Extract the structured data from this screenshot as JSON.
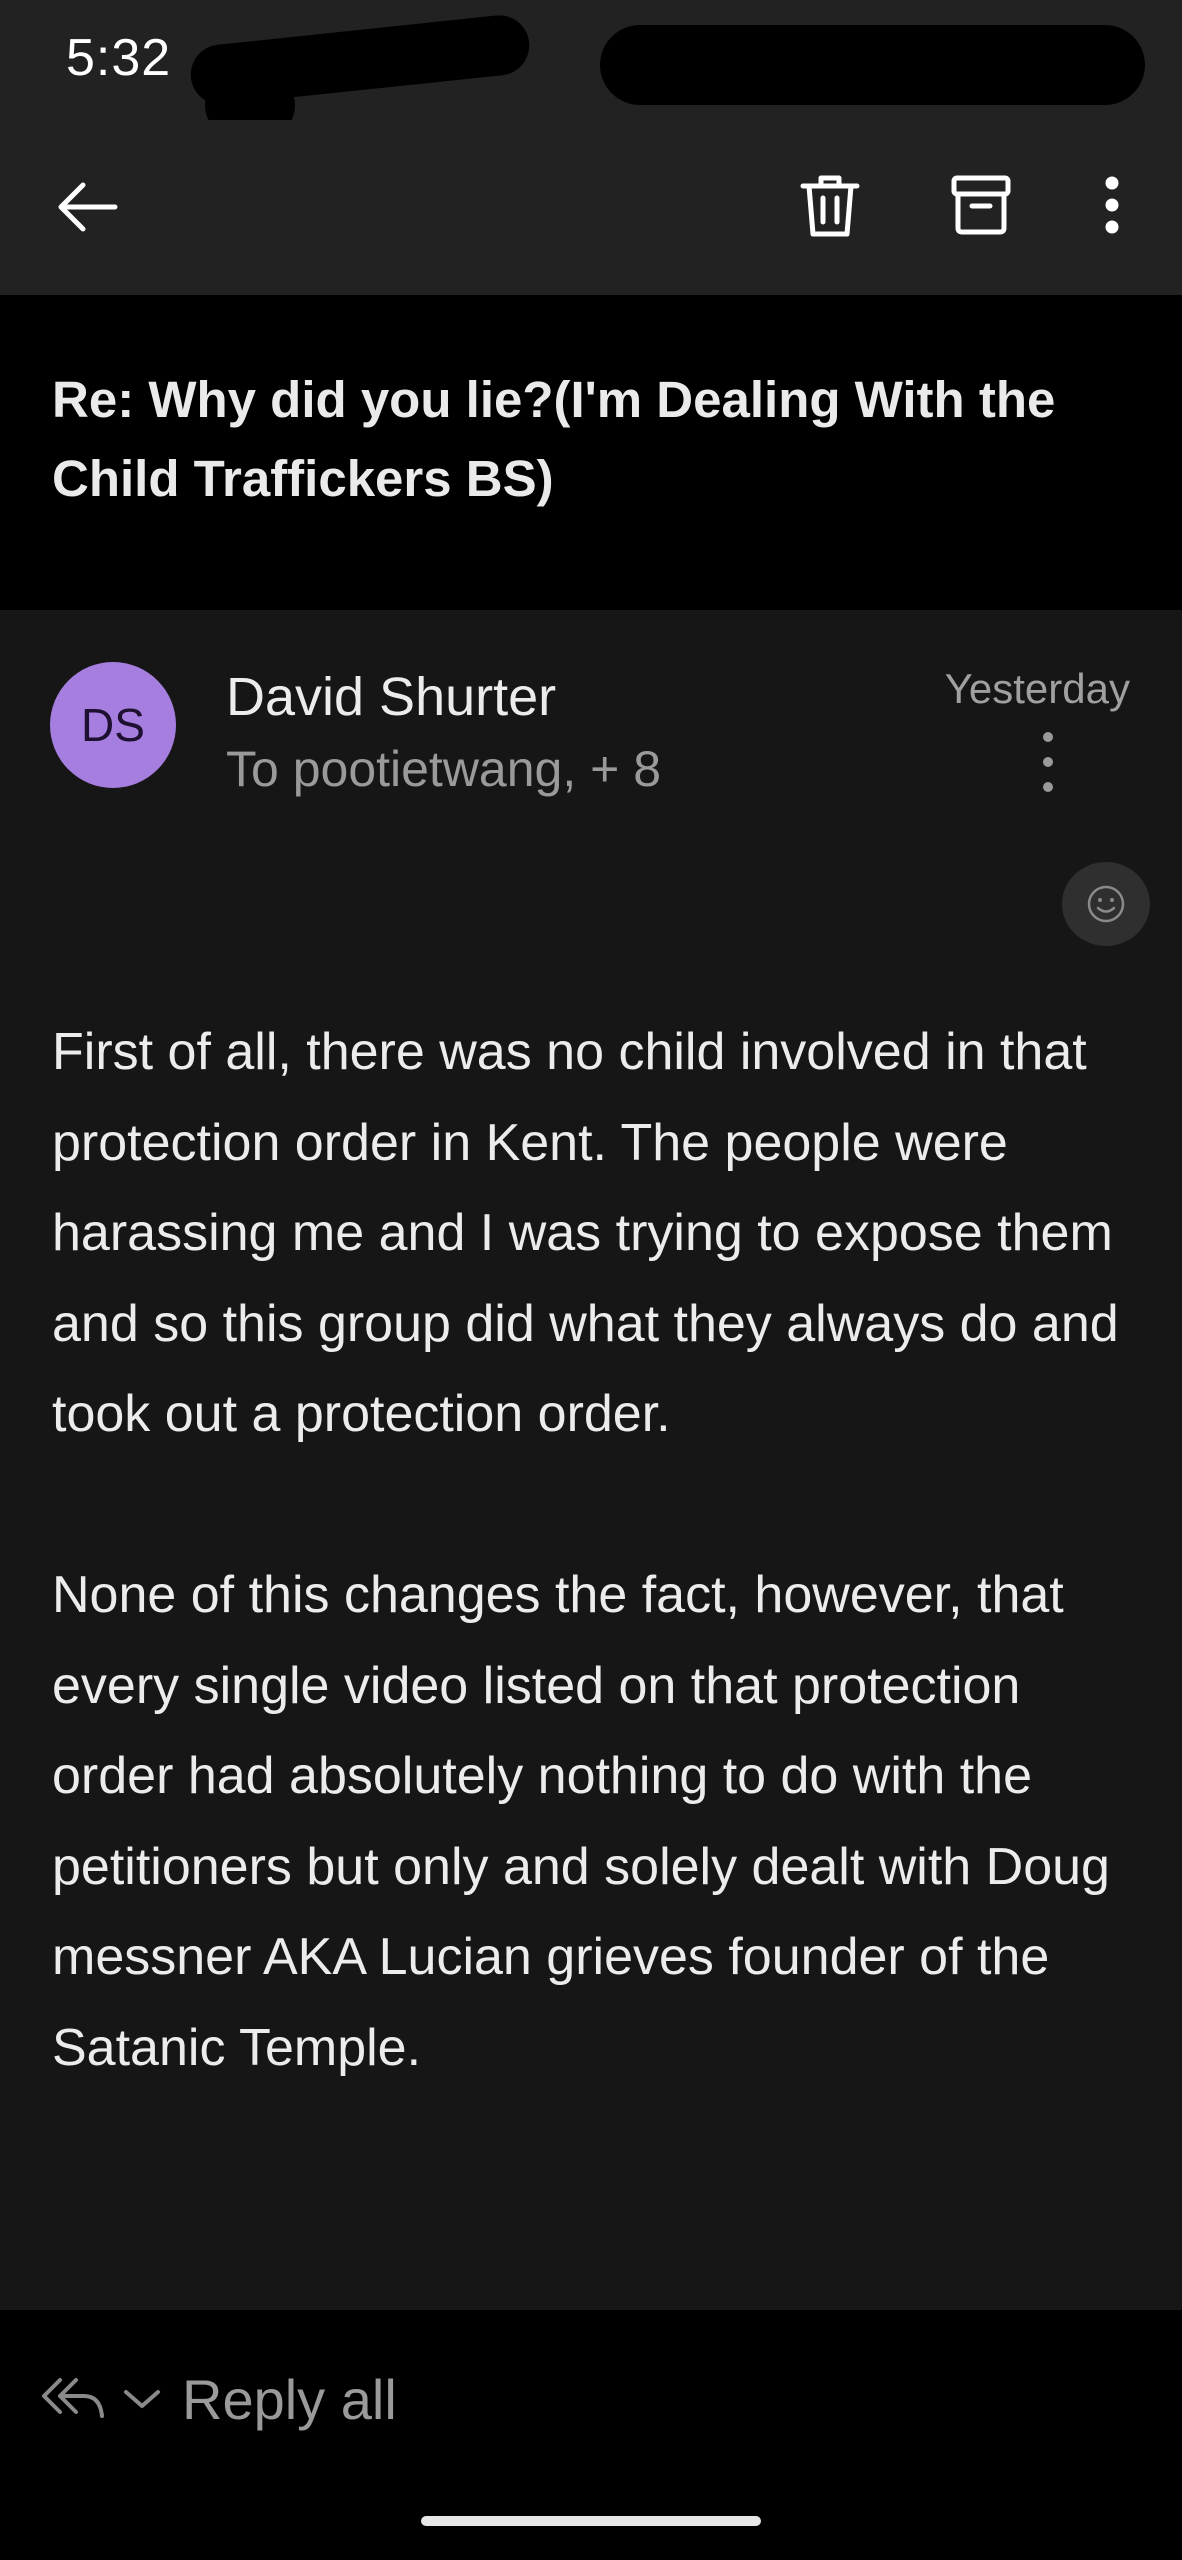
{
  "status_bar": {
    "time": "5:32"
  },
  "toolbar": {
    "back_icon": "arrow-left-icon",
    "delete_icon": "trash-icon",
    "archive_icon": "archive-box-icon",
    "more_icon": "kebab-vertical-icon"
  },
  "subject": "Re: Why did you lie?(I'm Dealing With the Child Traffickers BS)",
  "message": {
    "avatar_initials": "DS",
    "avatar_color": "#a67ee0",
    "sender": "David Shurter",
    "recipients": "To pootietwang, + 8",
    "date": "Yesterday",
    "paragraphs": [
      "First of all, there was no child involved in that protection order in Kent. The people were harassing me and I was trying to expose them and so this group did what they always do and took out a protection order.",
      "None of this changes the fact, however, that every single video listed on that protection order had absolutely nothing to do with the petitioners but only and solely dealt with Doug messner AKA Lucian grieves founder of the Satanic Temple."
    ]
  },
  "footer": {
    "reply_all_label": "Reply all"
  },
  "colors": {
    "background": "#161616",
    "bar": "#222222",
    "accent": "#a67ee0"
  }
}
